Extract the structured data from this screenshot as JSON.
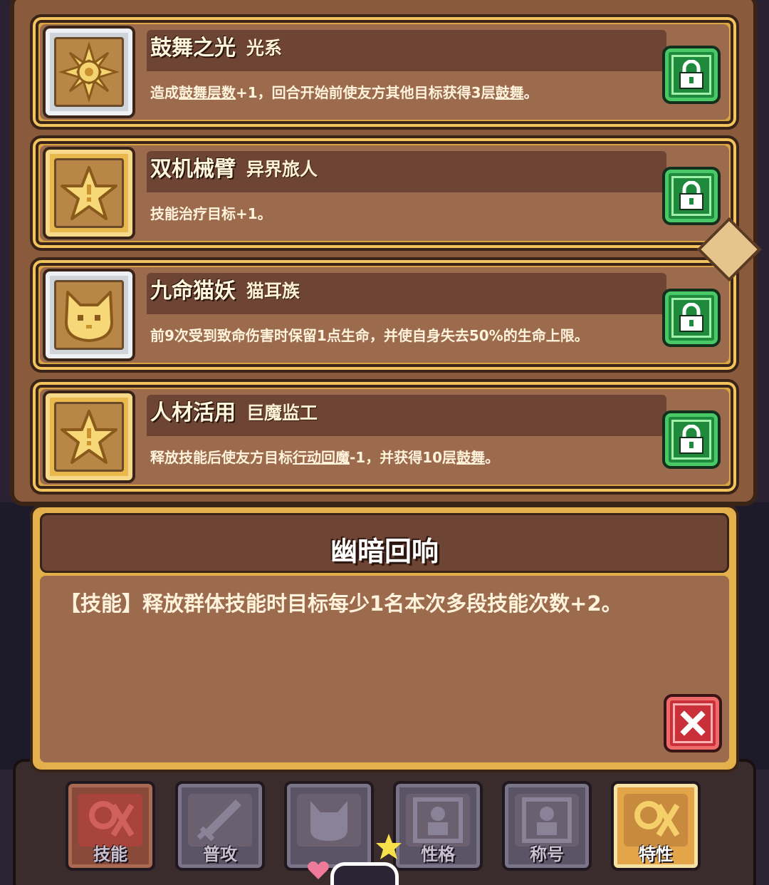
{
  "cards": [
    {
      "title": "鼓舞之光",
      "subtitle": "光系",
      "desc_parts": [
        "造成",
        "鼓舞层数",
        "+1，回合开始前使友方其他目标获得3层",
        "鼓舞",
        "。"
      ],
      "icon": "sun-icon",
      "frame": "silver"
    },
    {
      "title": "双机械臂",
      "subtitle": "异界旅人",
      "desc_parts": [
        "技能治疗目标+1。"
      ],
      "icon": "star-icon",
      "frame": "gold"
    },
    {
      "title": "九命猫妖",
      "subtitle": "猫耳族",
      "desc_parts": [
        "前9次受到致命伤害时保留1点生命，并使自身失去50%的生命上限。"
      ],
      "icon": "cat-icon",
      "frame": "silver"
    },
    {
      "title": "人材活用",
      "subtitle": "巨魔监工",
      "desc_parts": [
        "释放技能后使友方目标",
        "行动回魔",
        "-1，并获得10层",
        "鼓舞",
        "。"
      ],
      "icon": "star-icon",
      "frame": "gold"
    }
  ],
  "popup": {
    "title": "幽暗回响",
    "description": "【技能】释放群体技能时目标每少1名本次多段技能次数+2。"
  },
  "tabs": [
    {
      "label": "技能",
      "icon": "skill-icon"
    },
    {
      "label": "普攻",
      "icon": "sword-icon"
    },
    {
      "label": "",
      "icon": "pet-icon"
    },
    {
      "label": "性格",
      "icon": "personality-icon"
    },
    {
      "label": "称号",
      "icon": "title-icon"
    },
    {
      "label": "特性",
      "icon": "trait-icon"
    }
  ],
  "colors": {
    "lock_green": "#1f8a3c",
    "close_red": "#c9303a",
    "card_gold": "#d9a441",
    "panel_brown": "#9c6b4e"
  }
}
